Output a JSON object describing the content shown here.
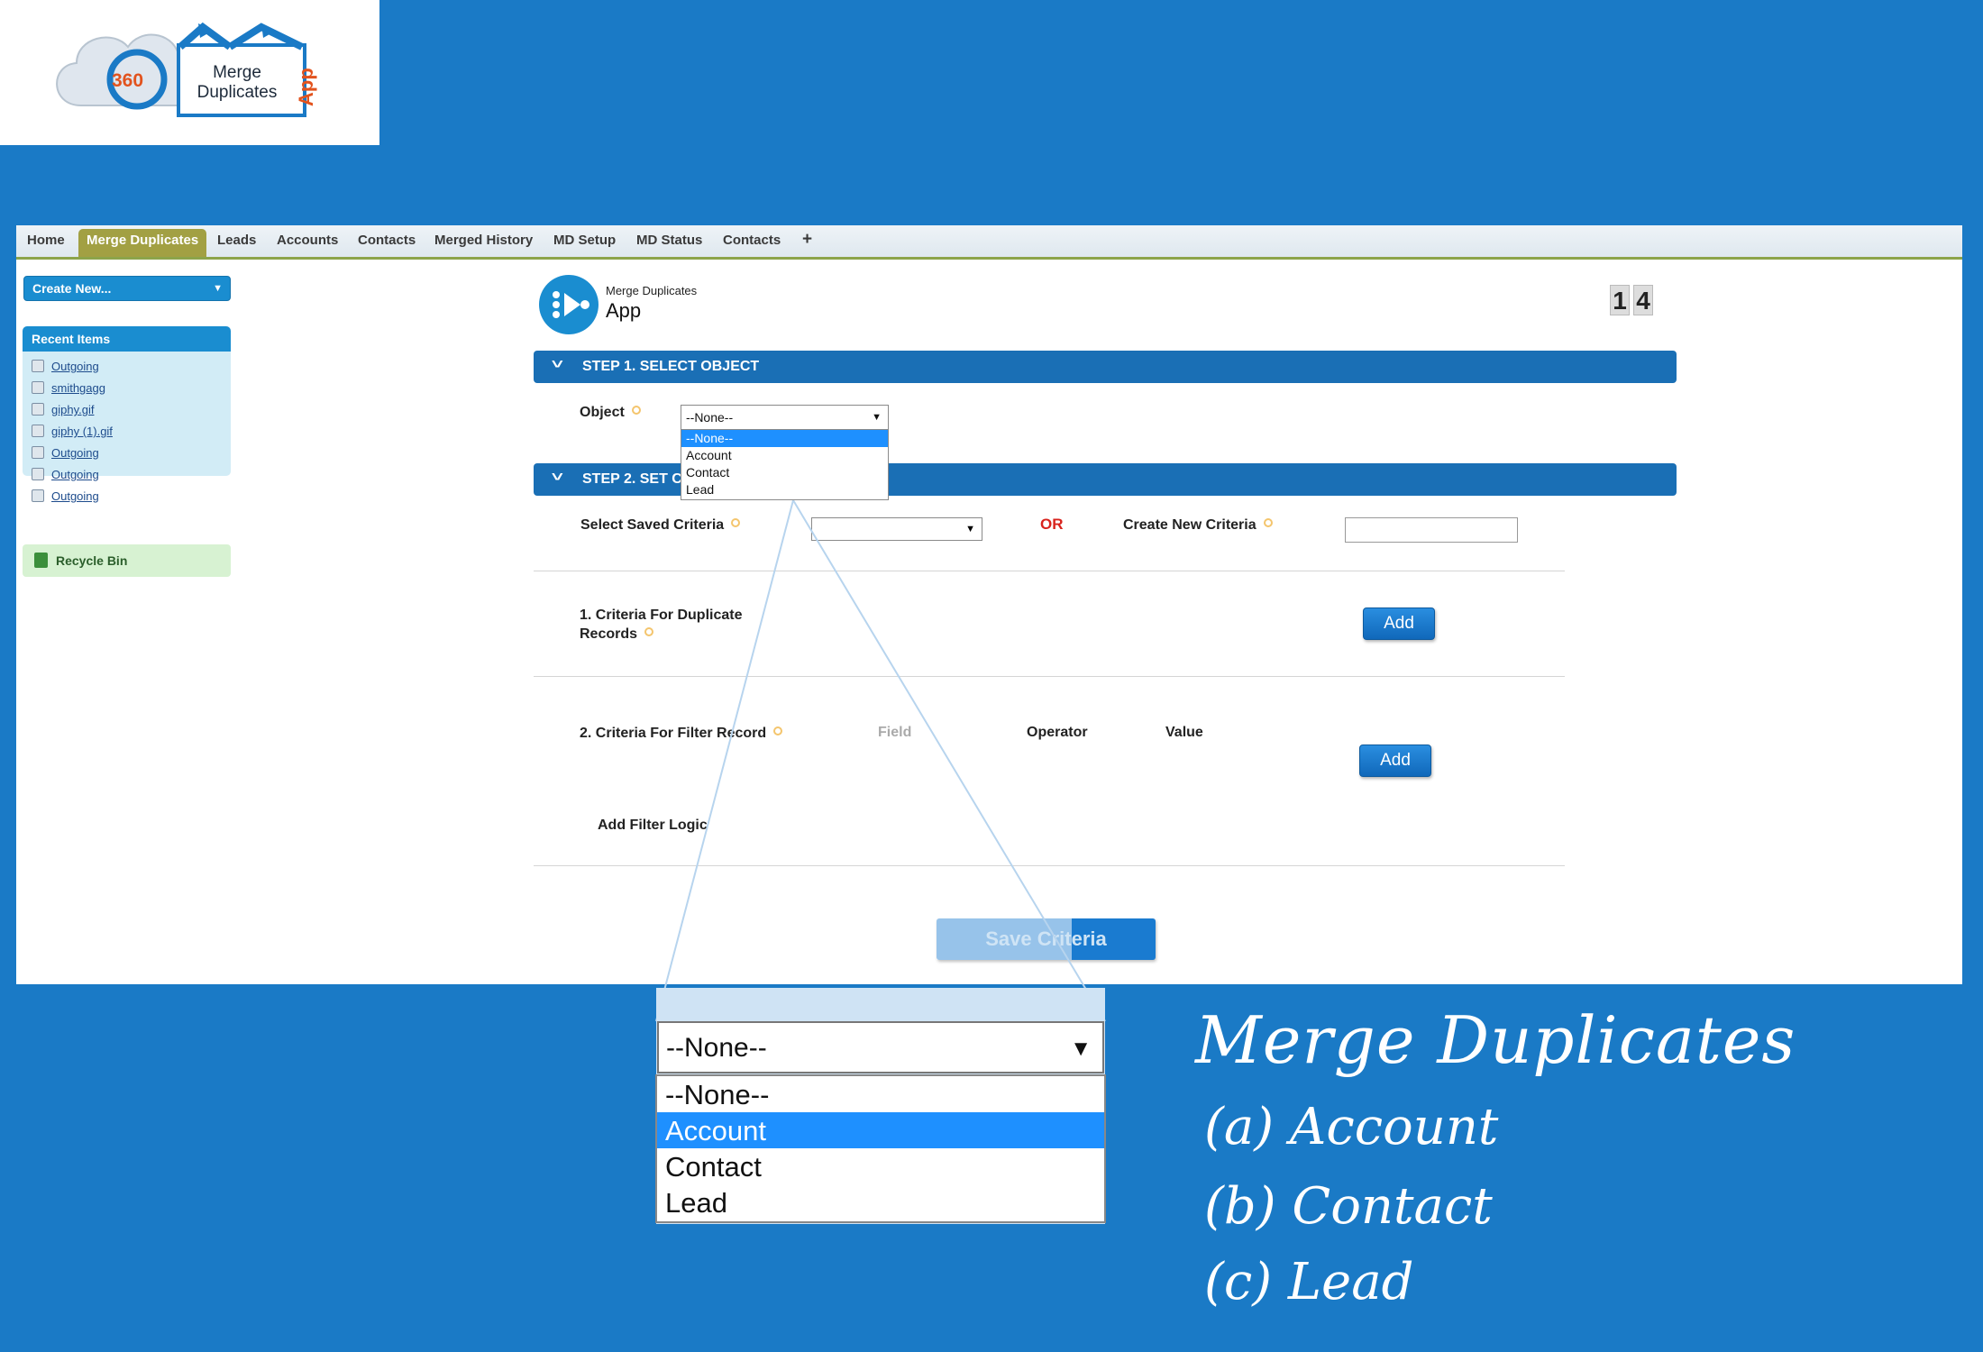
{
  "logo": {
    "badge": "360",
    "merge_line1": "Merge",
    "merge_line2": "Duplicates",
    "app": "App"
  },
  "tabs": [
    {
      "label": "Home",
      "active": false
    },
    {
      "label": "Merge Duplicates",
      "active": true
    },
    {
      "label": "Leads",
      "active": false
    },
    {
      "label": "Accounts",
      "active": false
    },
    {
      "label": "Contacts",
      "active": false
    },
    {
      "label": "Merged History",
      "active": false
    },
    {
      "label": "MD Setup",
      "active": false
    },
    {
      "label": "MD Status",
      "active": false
    },
    {
      "label": "Contacts",
      "active": false
    }
  ],
  "tab_add": "+",
  "sidebar": {
    "create_new": "Create New...",
    "recent_title": "Recent Items",
    "recent_items": [
      "Outgoing",
      "smithgagg",
      "giphy.gif",
      "giphy (1).gif",
      "Outgoing",
      "Outgoing",
      "Outgoing"
    ],
    "recycle_bin": "Recycle Bin"
  },
  "app_header": {
    "subtitle": "Merge Duplicates",
    "title": "App",
    "counter": [
      "1",
      "4"
    ]
  },
  "step1": {
    "title": "STEP 1. SELECT OBJECT",
    "object_label": "Object",
    "object_value": "--None--",
    "object_options": [
      "--None--",
      "Account",
      "Contact",
      "Lead"
    ],
    "highlighted": "--None--"
  },
  "step2": {
    "title": "STEP 2. SET C",
    "saved_label": "Select Saved Criteria",
    "saved_value": "",
    "or_label": "OR",
    "create_label": "Create New Criteria",
    "create_value": "",
    "dup_label_line1": "1. Criteria For Duplicate",
    "dup_label_line2": "Records",
    "add_label": "Add",
    "filter_label": "2. Criteria For Filter Record",
    "field_col": "Field",
    "operator_col": "Operator",
    "value_col": "Value",
    "add_label_2": "Add",
    "filter_logic": "Add Filter Logic",
    "save_label": "Save Criteria"
  },
  "zoom": {
    "value": "--None--",
    "options": [
      "--None--",
      "Account",
      "Contact",
      "Lead"
    ],
    "highlighted": "Account"
  },
  "caption": {
    "title": "Merge Duplicates",
    "items": [
      "(a) Account",
      "(b) Contact",
      "(c) Lead"
    ]
  },
  "colors": {
    "background": "#1a7ac6",
    "step_bar": "#1a6fb5",
    "active_tab": "#a2a043",
    "highlight": "#1e90ff",
    "or": "#d8231d"
  }
}
